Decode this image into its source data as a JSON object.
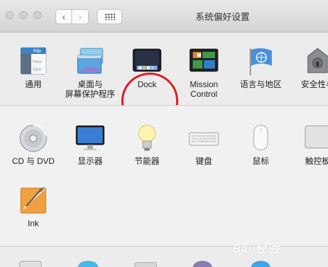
{
  "window": {
    "title": "系统偏好设置",
    "nav": {
      "back": "‹",
      "forward": "›"
    }
  },
  "row1": [
    {
      "name": "通用",
      "icon": "general-icon",
      "file_word": "File",
      "file_word2": "New",
      "file_word3": "Ope"
    },
    {
      "name": "桌面与\n屏幕保护程序",
      "icon": "desktop-screensaver-icon"
    },
    {
      "name": "Dock",
      "icon": "dock-icon"
    },
    {
      "name": "Mission\nControl",
      "icon": "mission-control-icon"
    },
    {
      "name": "语言与地区",
      "icon": "language-region-icon"
    },
    {
      "name": "安全性与",
      "icon": "security-privacy-icon"
    }
  ],
  "row2": [
    {
      "name": "CD 与 DVD",
      "icon": "cd-dvd-icon"
    },
    {
      "name": "显示器",
      "icon": "displays-icon"
    },
    {
      "name": "节能器",
      "icon": "energy-saver-icon"
    },
    {
      "name": "键盘",
      "icon": "keyboard-icon"
    },
    {
      "name": "鼠标",
      "icon": "mouse-icon"
    },
    {
      "name": "触控板",
      "icon": "trackpad-icon"
    }
  ],
  "row3": [
    {
      "name": "Ink",
      "icon": "ink-icon"
    }
  ],
  "watermark": "Bai 经验",
  "colors": {
    "annotation": "#e3161b",
    "accent": "#4a90d9"
  }
}
